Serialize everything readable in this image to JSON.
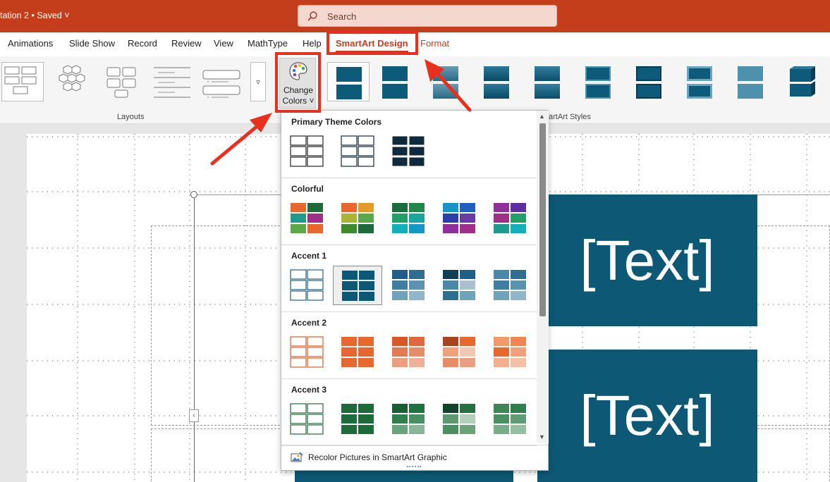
{
  "titlebar": {
    "doc_title": "tation 2 • Saved ˅",
    "search_placeholder": "Search",
    "background": "#c43e1c"
  },
  "tabs": [
    {
      "label": "Animations"
    },
    {
      "label": "Slide Show"
    },
    {
      "label": "Record"
    },
    {
      "label": "Review"
    },
    {
      "label": "View"
    },
    {
      "label": "MathType"
    },
    {
      "label": "Help"
    },
    {
      "label": "SmartArt Design"
    },
    {
      "label": "Format"
    }
  ],
  "ribbon": {
    "layouts_label": "Layouts",
    "change_colors_line1": "Change",
    "change_colors_line2": "Colors ˅",
    "styles_label": "artArt Styles",
    "gallery_more_icon": "▿"
  },
  "dropdown": {
    "sections": [
      {
        "title": "Primary Theme Colors"
      },
      {
        "title": "Colorful"
      },
      {
        "title": "Accent 1"
      },
      {
        "title": "Accent 2"
      },
      {
        "title": "Accent 3"
      }
    ],
    "recolor_label": "Recolor Pictures in SmartArt Graphic",
    "scroll_up": "▲",
    "scroll_down": "▼"
  },
  "slide": {
    "text_1": "[Text]",
    "text_2": "[Text]",
    "block_color": "#0d5875",
    "side_tab_icon": "‹"
  },
  "colors": {
    "accent": "#c43e1c",
    "highlight": "#e8301e",
    "smartart_blue": "#0d5875"
  }
}
